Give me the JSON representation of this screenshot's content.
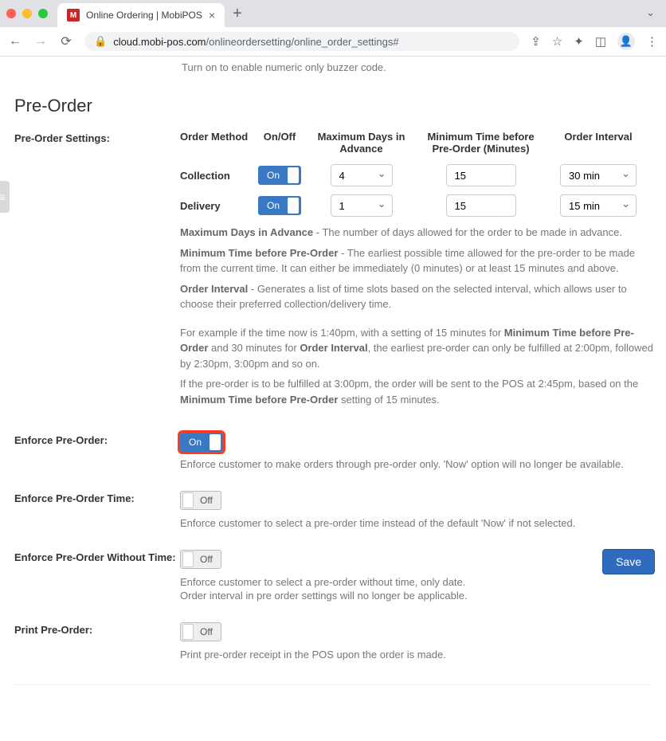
{
  "browser": {
    "tab_title": "Online Ordering | MobiPOS",
    "url_host": "cloud.mobi-pos.com",
    "url_path": "/onlineordersetting/online_order_settings#"
  },
  "top_text": "Turn on to enable numeric only buzzer code.",
  "section_title": "Pre-Order",
  "settings_label": "Pre-Order Settings:",
  "headers": {
    "order_method": "Order Method",
    "on_off": "On/Off",
    "max_days": "Maximum Days in Advance",
    "min_time": "Minimum Time before Pre-Order (Minutes)",
    "interval": "Order Interval"
  },
  "rows": {
    "collection": {
      "label": "Collection",
      "toggle": "On",
      "max_days": "4",
      "min_time": "15",
      "interval": "30 min"
    },
    "delivery": {
      "label": "Delivery",
      "toggle": "On",
      "max_days": "1",
      "min_time": "15",
      "interval": "15 min"
    }
  },
  "help": {
    "p1a": "Maximum Days in Advance",
    "p1b": " - The number of days allowed for the order to be made in advance.",
    "p2a": "Minimum Time before Pre-Order",
    "p2b": " - The earliest possible time allowed for the pre-order to be made from the current time. It can either be immediately (0 minutes) or at least 15 minutes and above.",
    "p3a": "Order Interval",
    "p3b": " - Generates a list of time slots based on the selected interval, which allows user to choose their preferred collection/delivery time.",
    "ex1a": "For example if the time now is 1:40pm, with a setting of 15 minutes for ",
    "ex1b": "Minimum Time before Pre-Order",
    "ex1c": " and 30 minutes for ",
    "ex1d": "Order Interval",
    "ex1e": ", the earliest pre-order can only be fulfilled at 2:00pm, followed by 2:30pm, 3:00pm and so on.",
    "ex2a": "If the pre-order is to be fulfilled at 3:00pm, the order will be sent to the POS at 2:45pm, based on the ",
    "ex2b": "Minimum Time before Pre-Order",
    "ex2c": " setting of 15 minutes."
  },
  "enforce_preorder": {
    "label": "Enforce Pre-Order:",
    "toggle": "On",
    "desc": "Enforce customer to make orders through pre-order only. 'Now' option will no longer be available."
  },
  "enforce_time": {
    "label": "Enforce Pre-Order Time:",
    "toggle": "Off",
    "desc": "Enforce customer to select a pre-order time instead of the default 'Now' if not selected."
  },
  "enforce_without_time": {
    "label": "Enforce Pre-Order Without Time:",
    "toggle": "Off",
    "desc1": "Enforce customer to select a pre-order without time, only date.",
    "desc2": "Order interval in pre order settings will no longer be applicable."
  },
  "print_preorder": {
    "label": "Print Pre-Order:",
    "toggle": "Off",
    "desc": "Print pre-order receipt in the POS upon the order is made."
  },
  "save_label": "Save"
}
